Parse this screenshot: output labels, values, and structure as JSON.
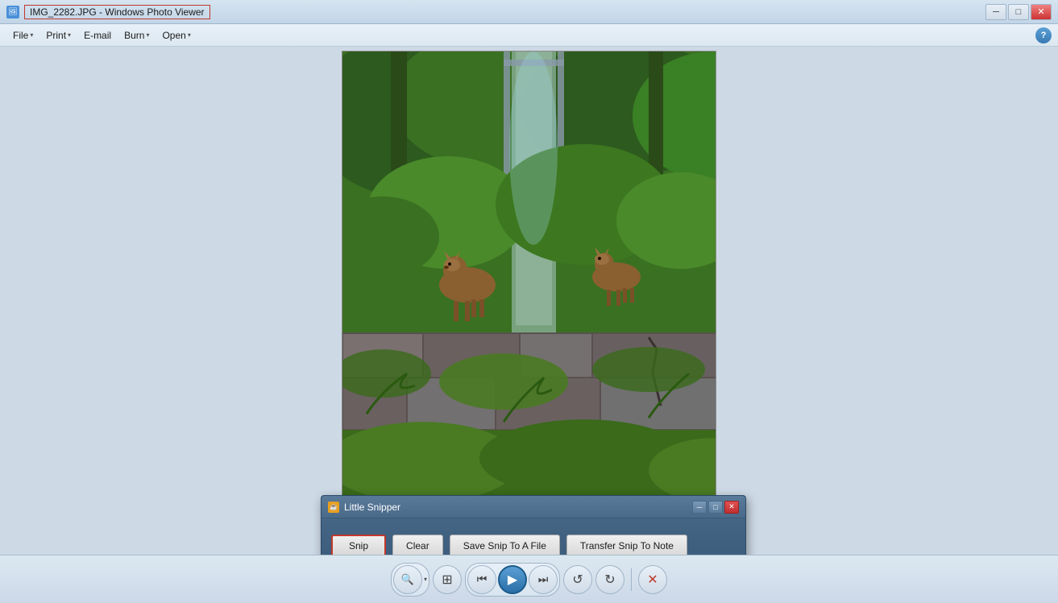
{
  "titlebar": {
    "title": "IMG_2282.JPG - Windows Photo Viewer",
    "minimize_label": "─",
    "restore_label": "□",
    "close_label": "✕"
  },
  "menubar": {
    "items": [
      {
        "id": "file",
        "label": "File",
        "has_arrow": true
      },
      {
        "id": "print",
        "label": "Print",
        "has_arrow": true
      },
      {
        "id": "email",
        "label": "E-mail",
        "has_arrow": false
      },
      {
        "id": "burn",
        "label": "Burn",
        "has_arrow": true
      },
      {
        "id": "open",
        "label": "Open",
        "has_arrow": true
      }
    ],
    "help_label": "?"
  },
  "toolbar": {
    "buttons": [
      {
        "id": "zoom-in",
        "icon": "🔍",
        "label": "Zoom In",
        "active": false,
        "has_arrow": true
      },
      {
        "id": "fit",
        "icon": "⊞",
        "label": "Actual Size",
        "active": false
      },
      {
        "id": "prev",
        "icon": "⏮",
        "label": "Previous",
        "active": false
      },
      {
        "id": "slideshow",
        "icon": "▶",
        "label": "Slideshow",
        "active": true
      },
      {
        "id": "next",
        "icon": "⏭",
        "label": "Next",
        "active": false
      },
      {
        "id": "rotate-ccw",
        "icon": "↺",
        "label": "Rotate CCW",
        "active": false
      },
      {
        "id": "rotate-cw",
        "icon": "↻",
        "label": "Rotate CW",
        "active": false
      },
      {
        "id": "delete",
        "icon": "✕",
        "label": "Delete",
        "active": false
      }
    ]
  },
  "snipper": {
    "title": "Little Snipper",
    "icon_label": "☕",
    "minimize_label": "─",
    "restore_label": "□",
    "close_label": "✕",
    "buttons": {
      "snip": "Snip",
      "clear": "Clear",
      "save_to_file": "Save Snip To A File",
      "transfer_to_note": "Transfer Snip To Note"
    }
  }
}
